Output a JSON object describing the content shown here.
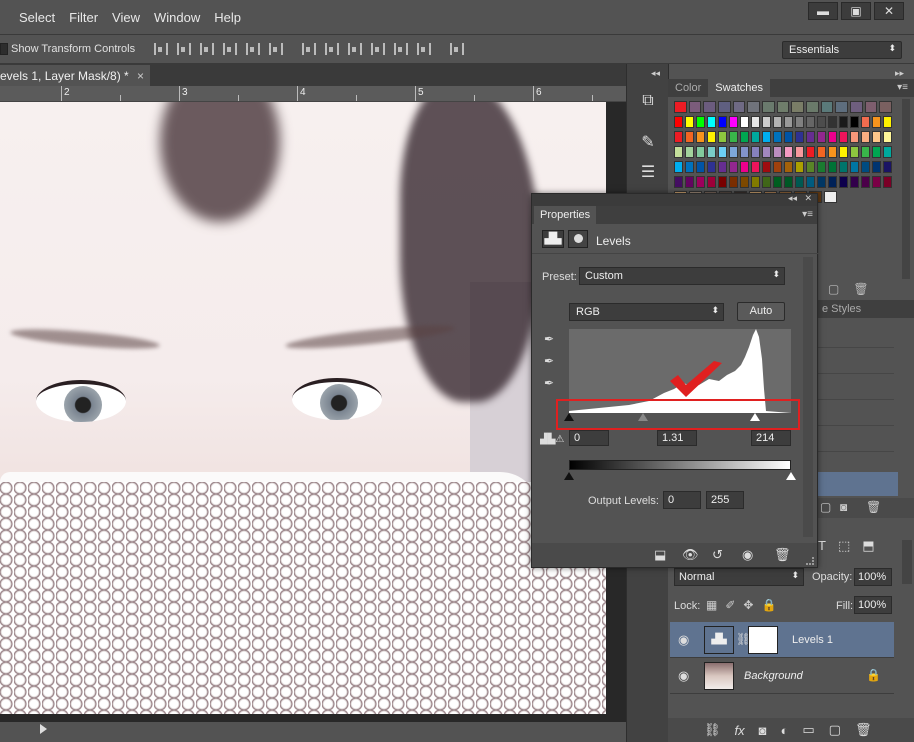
{
  "menu": [
    "Select",
    "Filter",
    "View",
    "Window",
    "Help"
  ],
  "window_buttons": {
    "minimize": "▬",
    "maximize": "▣",
    "close": "✕"
  },
  "options_bar": {
    "show_transform_label": "Show Transform Controls",
    "workspace": "Essentials"
  },
  "document": {
    "tab_title": "evels 1, Layer Mask/8) *",
    "close": "×",
    "ruler_numbers": [
      "2",
      "3",
      "4",
      "5",
      "6"
    ]
  },
  "swatches_panel": {
    "tabs": [
      "Color",
      "Swatches"
    ],
    "active_tab": "Swatches",
    "rows": [
      [
        "#ed1c24",
        "#7b5c7b",
        "#6b5c7e",
        "#5f5f80",
        "#6f6a84",
        "#70737b",
        "#6a7a6d",
        "#6f7d6b",
        "#7a7d67",
        "#6a7a6a",
        "#5a7a7a",
        "#5e6e7e",
        "#6e5e7e",
        "#7e5e6e",
        "#7a6060"
      ],
      [
        "#ff0000",
        "#ffff00",
        "#00ff00",
        "#00ffff",
        "#0000ff",
        "#ff00ff",
        "#ffffff",
        "#e6e6e6",
        "#cccccc",
        "#b3b3b3",
        "#999999",
        "#808080",
        "#666666",
        "#4d4d4d",
        "#333333",
        "#1a1a1a",
        "#000000",
        "#f26c4f",
        "#f7941d",
        "#fff200"
      ],
      [
        "#ed1c24",
        "#f26522",
        "#f7941d",
        "#fff200",
        "#8dc63f",
        "#39b54a",
        "#00a651",
        "#00a99d",
        "#00aeef",
        "#0072bc",
        "#0054a6",
        "#2e3192",
        "#662d91",
        "#92278f",
        "#ec008c",
        "#ed145b",
        "#f7977a",
        "#f9ad81",
        "#fdc68a",
        "#fff799"
      ],
      [
        "#c4df9b",
        "#a3d39c",
        "#82ca9d",
        "#7accc8",
        "#6dcff6",
        "#7da7d9",
        "#8393ca",
        "#8781bd",
        "#a187be",
        "#bc8dbf",
        "#f49ac2",
        "#f6989d",
        "#ed1c24",
        "#f26522",
        "#f7941d",
        "#fff200",
        "#8dc63f",
        "#39b54a",
        "#00a651",
        "#00a99d"
      ],
      [
        "#00aeef",
        "#0072bc",
        "#0054a6",
        "#2e3192",
        "#662d91",
        "#92278f",
        "#ec008c",
        "#ed145b",
        "#9e0b0f",
        "#a0410d",
        "#a3620a",
        "#aba000",
        "#598527",
        "#1a7b30",
        "#007236",
        "#00746b",
        "#0076a3",
        "#004b80",
        "#003471",
        "#1b1464"
      ],
      [
        "#440e62",
        "#630460",
        "#9e005d",
        "#9e0039",
        "#790000",
        "#7b2e00",
        "#7d4900",
        "#827b00",
        "#406618",
        "#005e20",
        "#005826",
        "#005952",
        "#005b7f",
        "#003663",
        "#002157",
        "#0d004c",
        "#32004b",
        "#4b0049",
        "#7b0046",
        "#7a0026"
      ],
      [
        "#c69c6d",
        "#998675",
        "#736357",
        "#534741",
        "#362f2d",
        "#c69c6d",
        "#a67c52",
        "#8c6239",
        "#754c24",
        "#603913",
        "#eeeeee"
      ]
    ]
  },
  "styles_panel": {
    "tab_label": "e   Styles",
    "footer_icons": [
      "new-layer",
      "camera",
      "trash"
    ]
  },
  "layers_panel": {
    "toolbar_icons": [
      "T",
      "⬚",
      "⬒"
    ],
    "blend_mode": "Normal",
    "opacity_label": "Opacity:",
    "opacity_value": "100%",
    "lock_label": "Lock:",
    "fill_label": "Fill:",
    "fill_value": "100%",
    "layers": [
      {
        "name": "Levels 1",
        "selected": true,
        "italic": false
      },
      {
        "name": "Background",
        "selected": false,
        "italic": true
      }
    ],
    "footer_icons": [
      "link",
      "fx",
      "mask",
      "adjust",
      "folder",
      "new",
      "trash"
    ]
  },
  "properties_panel": {
    "tab": "Properties",
    "title": "Levels",
    "preset_label": "Preset:",
    "preset_value": "Custom",
    "channel": "RGB",
    "auto_label": "Auto",
    "input_levels": {
      "black": "0",
      "gamma": "1.31",
      "white": "214"
    },
    "input_slider_positions": {
      "black": 0,
      "gamma": 0.335,
      "white": 0.84
    },
    "output_label": "Output Levels:",
    "output_levels": {
      "low": "0",
      "high": "255"
    },
    "highlight_color": "#e02020"
  },
  "colors": {
    "ui_bg": "#535353",
    "panel_dark": "#3f3f3f",
    "selection": "#5f7390"
  }
}
